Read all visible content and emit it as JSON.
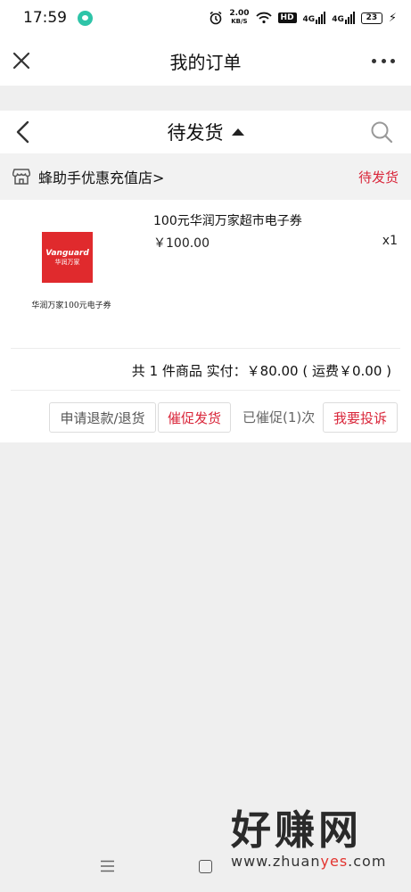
{
  "status_bar": {
    "time": "17:59",
    "net_speed_value": "2.00",
    "net_speed_unit": "KB/S",
    "hd_label": "HD",
    "signal1_label": "4G",
    "signal2_label": "4G",
    "battery_level": "23"
  },
  "title_bar": {
    "title": "我的订单"
  },
  "sub_nav": {
    "filter_label": "待发货"
  },
  "store": {
    "name": "蜂助手优惠充值店>",
    "status": "待发货"
  },
  "product": {
    "brand_logo_en": "Vanguard",
    "brand_logo_cn": "华润万家",
    "thumb_caption": "华润万家100元电子券",
    "name": "100元华润万家超市电子券",
    "price": "￥100.00",
    "quantity": "x1"
  },
  "summary": {
    "text": "共 1 件商品  实付：￥80.00 ( 运费￥0.00 )"
  },
  "actions": {
    "refund_label": "申请退款/退货",
    "urge_label": "催促发货",
    "urged_text": "已催促(1)次",
    "complain_label": "我要投诉"
  },
  "watermark": {
    "big_text": "好赚网",
    "url_prefix": "www.zhuan",
    "url_accent": "yes",
    "url_suffix": ".com"
  },
  "colors": {
    "accent_red": "#d9263a",
    "background": "#efefef"
  }
}
